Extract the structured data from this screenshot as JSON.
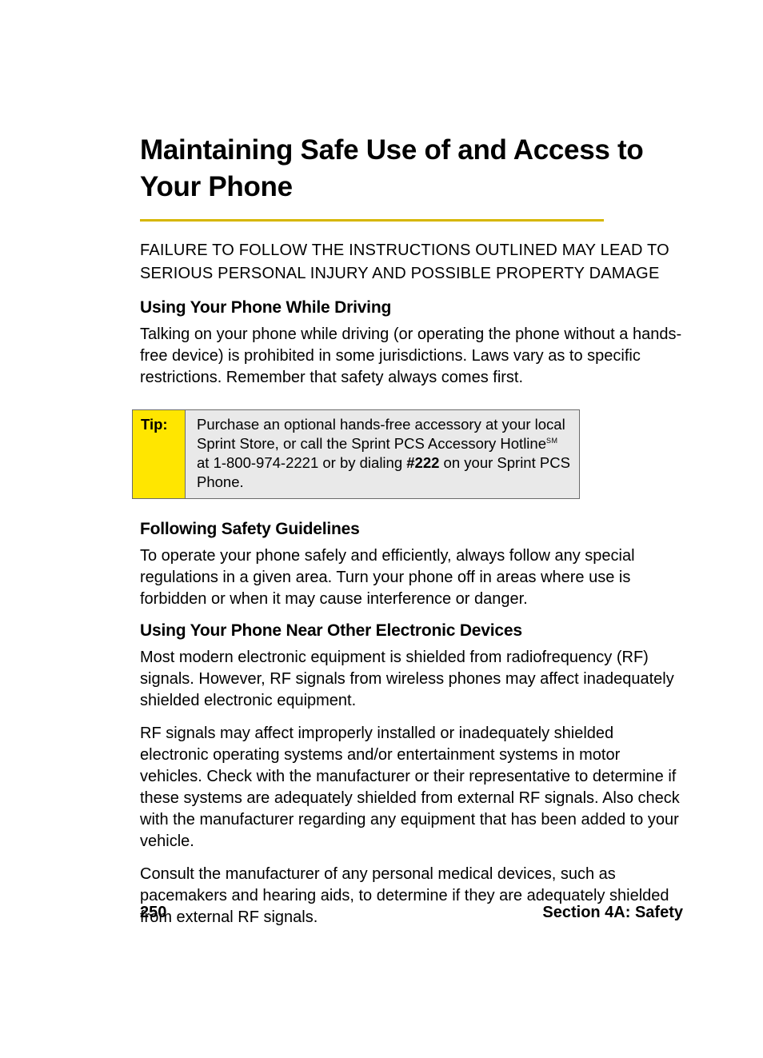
{
  "title": "Maintaining Safe Use of and Access to Your Phone",
  "warning": "FAILURE TO FOLLOW THE INSTRUCTIONS OUTLINED MAY LEAD TO SERIOUS PERSONAL INJURY AND POSSIBLE PROPERTY DAMAGE",
  "sections": {
    "driving": {
      "heading": "Using Your Phone While Driving",
      "body": "Talking on your phone while driving (or operating the phone without a hands-free device) is prohibited in some jurisdictions. Laws vary as to specific restrictions. Remember that safety always comes first."
    },
    "guidelines": {
      "heading": "Following Safety Guidelines",
      "body": "To operate your phone safely and efficiently, always follow any special regulations in a given area. Turn your phone off in areas where use is forbidden or when it may cause interference or danger."
    },
    "devices": {
      "heading": "Using Your Phone Near Other Electronic Devices",
      "p1": "Most modern electronic equipment is shielded from radiofrequency (RF) signals. However, RF signals from wireless phones may affect inadequately shielded electronic equipment.",
      "p2": "RF signals may affect improperly installed or inadequately shielded electronic operating systems and/or entertainment systems in motor vehicles. Check with the manufacturer or their representative to determine if these systems are adequately shielded from external RF signals. Also check with the manufacturer regarding any equipment that has been added to your vehicle.",
      "p3": "Consult the manufacturer of any personal medical devices, such as pacemakers and hearing aids, to determine if they are adequately shielded from external RF signals."
    }
  },
  "tip": {
    "label": "Tip:",
    "pre": "Purchase an optional hands-free accessory at your local Sprint Store, or call the Sprint PCS Accessory Hotline",
    "sm": "SM",
    "mid": " at 1-800-974-2221 or by dialing ",
    "bold": "#222",
    "post": " on your Sprint PCS Phone."
  },
  "footer": {
    "page": "250",
    "section": "Section 4A: Safety"
  }
}
